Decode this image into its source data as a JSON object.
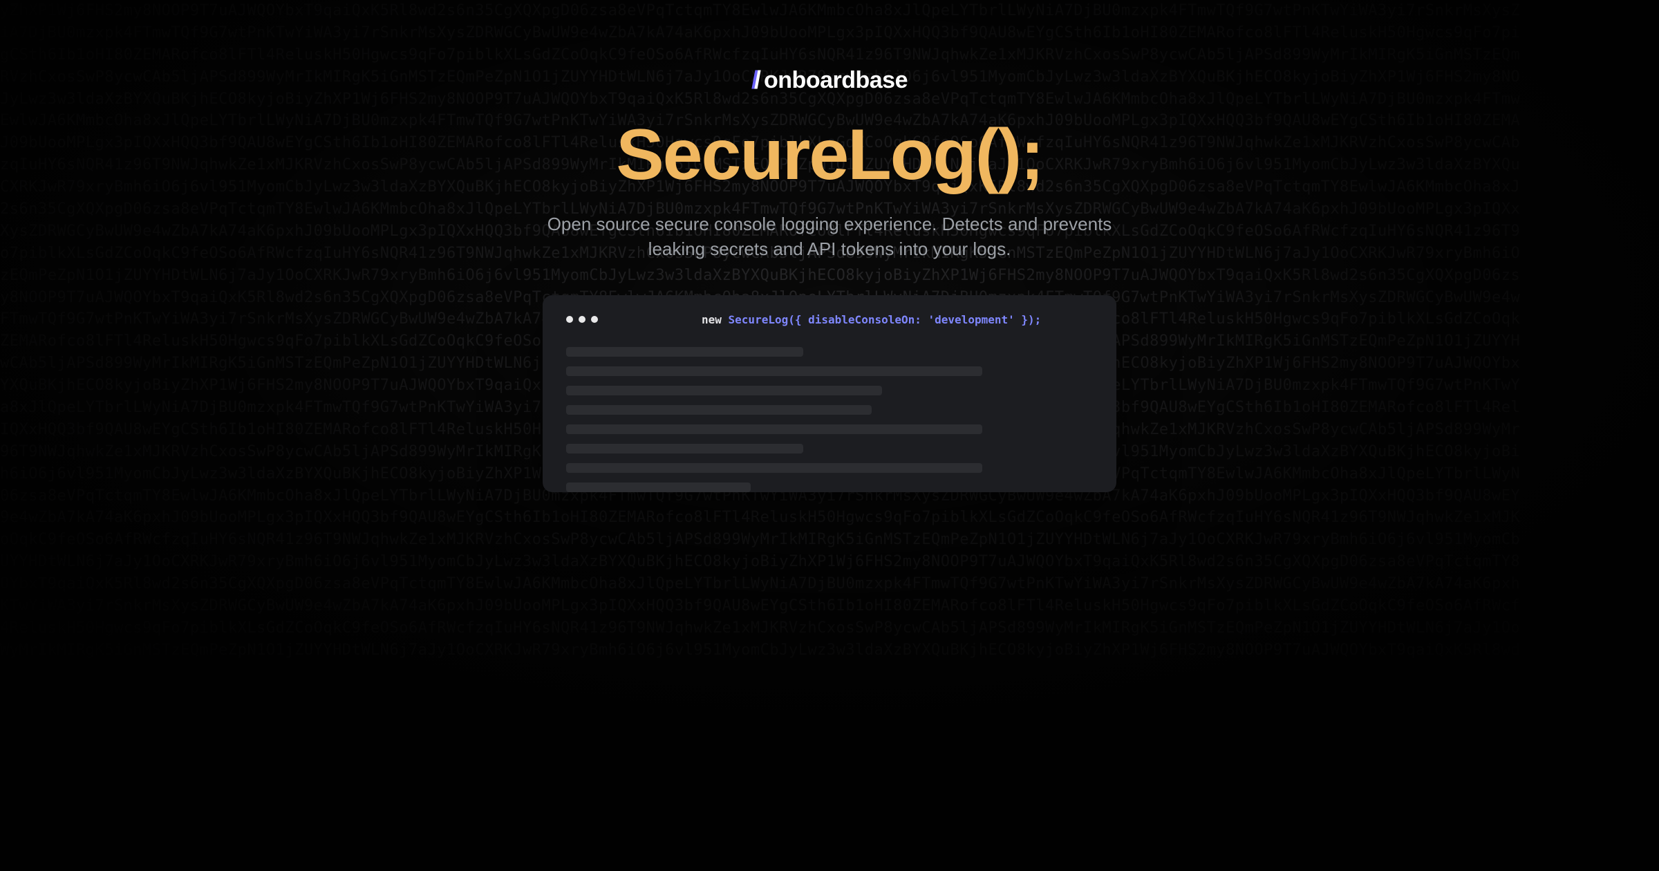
{
  "brand": {
    "name": "onboardbase"
  },
  "hero": {
    "title": "SecureLog();",
    "subtitle": "Open source secure console logging experience. Detects and prevents leaking secrets and API tokens into your logs."
  },
  "editor": {
    "code_prefix": "new ",
    "code_call": "SecureLog({ disableConsoleOn: 'development' });",
    "skeleton_widths": [
      45,
      79,
      60,
      58,
      79,
      45,
      79,
      35
    ]
  },
  "colors": {
    "accent": "#f0b75f",
    "brand_purple": "#6c63ff"
  },
  "background_noise_seed": "yZhXP1Wj6FHS2my8NOOP9T7uAJWQOYbxT9qaiQxK5Rl8wd2s6n35CgXQXpgD06zsa8eVPqTctqmTY8EwlwJA6KMmbcOha8xJlQpeLYTbrlLWyNiA7DjBU0mzxpk4FTmwTQf9G7wtPnKTwYiWA3yi7rSnkrMsXysZDRWGCyBwUW9e4wZbA7kA74aK6pxhJ09bUooMPLgx3pIQXxHQQ3bf9QAU8wEYgCSth6Ib1oHI80ZEMARofco8lFTl4ReluskH50Hgwcs9qFo7piblkXLsGdZCoOqkC9feOSo6AfRWcfzqIuHY6sNQR41z96T9NWJqhwkZe1xMJKRVzhCxosSwP8ycwCAb5ljAPSd899WyMrIkMIRgK5iGnMSTzEQmPeZpN1O1jZUYYHDtWLN6j7aJy1OoCXRKJwR79xryBmh6iO6j6vl951MyomCbJyLwz3w3ldaXzBYXQuBKjhECO8kyjoBi"
}
